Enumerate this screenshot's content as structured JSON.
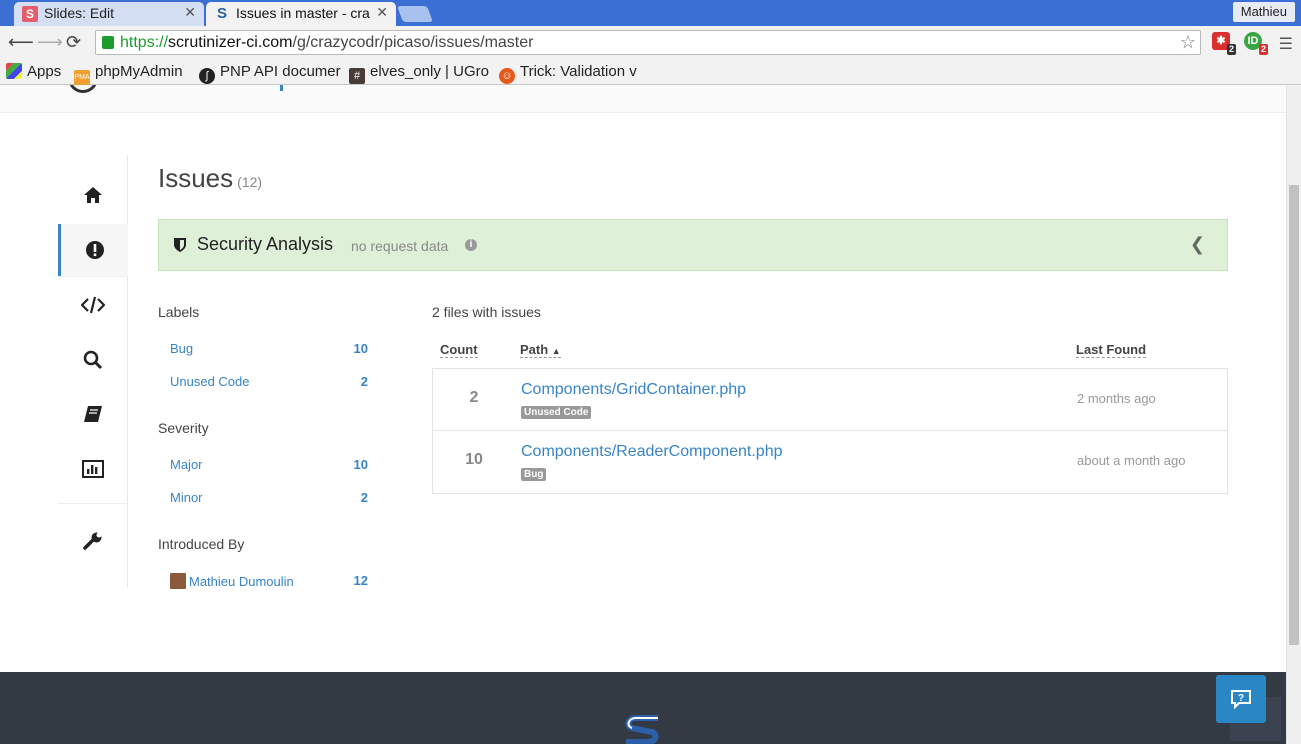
{
  "browser": {
    "tabs": [
      {
        "label": "Slides: Edit",
        "icon": "S",
        "icon_color": "#e35d6a",
        "active": false
      },
      {
        "label": "Issues in master - cra",
        "icon": "scrutinizer-logo",
        "active": true
      }
    ],
    "profile_name": "Mathieu",
    "url": {
      "scheme": "https://",
      "host": "scrutinizer-ci.com",
      "path": "/g/crazycodr/picaso/issues/master"
    },
    "extensions": [
      {
        "icon": "red-puzzle",
        "badge": "2",
        "color": "#d9302f"
      },
      {
        "icon": "green-circle",
        "badge": "2",
        "color": "#3aa544"
      }
    ],
    "bookmarks": [
      {
        "label": "Apps",
        "icon": "apps-grid-icon"
      },
      {
        "label": "phpMyAdmin",
        "icon": "phpmyadmin-icon"
      },
      {
        "label": "PNP API documer",
        "icon": "symfony-icon"
      },
      {
        "label": "elves_only | UGro",
        "icon": "hash-icon"
      },
      {
        "label": "Trick: Validation v",
        "icon": "trick-icon"
      }
    ]
  },
  "issues": {
    "title": "Issues",
    "count": "(12)",
    "security": {
      "title": "Security Analysis",
      "note": "no request data"
    },
    "filters": {
      "labels": {
        "heading": "Labels",
        "items": [
          {
            "label": "Bug",
            "count": "10"
          },
          {
            "label": "Unused Code",
            "count": "2"
          }
        ]
      },
      "severity": {
        "heading": "Severity",
        "items": [
          {
            "label": "Major",
            "count": "10"
          },
          {
            "label": "Minor",
            "count": "2"
          }
        ]
      },
      "introduced_by": {
        "heading": "Introduced By",
        "items": [
          {
            "label": "Mathieu Dumoulin",
            "count": "12"
          }
        ]
      }
    },
    "files_summary": "2 files with issues",
    "table": {
      "headers": {
        "count": "Count",
        "path": "Path",
        "last_found": "Last Found"
      },
      "sort_indicator": "▲",
      "rows": [
        {
          "count": "2",
          "path": "Components/GridContainer.php",
          "tag": "Unused Code",
          "last_found": "2 months ago"
        },
        {
          "count": "10",
          "path": "Components/ReaderComponent.php",
          "tag": "Bug",
          "last_found": "about a month ago"
        }
      ]
    }
  },
  "colors": {
    "accent": "#3884c7",
    "security_bg": "#dff0d8",
    "footer_bg": "#343a44",
    "tag_bg": "#999999"
  }
}
